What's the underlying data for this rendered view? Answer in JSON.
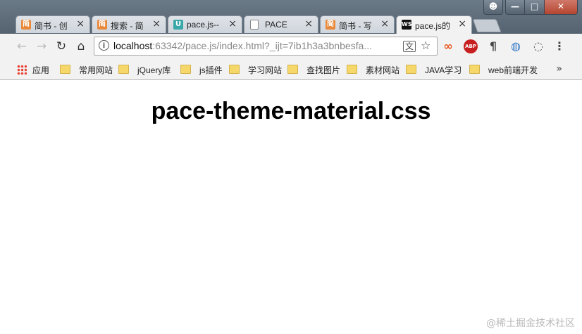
{
  "window": {
    "profile_icon": "person-icon",
    "minimize_icon": "minimize-icon",
    "maximize_icon": "maximize-icon",
    "close_icon": "close-icon"
  },
  "tabs": [
    {
      "title": "简书 - 创",
      "favicon": "简",
      "favicon_color": "#e8893c",
      "active": false
    },
    {
      "title": "搜索 - 简",
      "favicon": "简",
      "favicon_color": "#e8893c",
      "active": false
    },
    {
      "title": "pace.js--",
      "favicon": "U",
      "favicon_color": "#3aa8a8",
      "active": false
    },
    {
      "title": "PACE",
      "favicon": "doc",
      "favicon_color": "#ffffff",
      "active": false
    },
    {
      "title": "简书 - 写",
      "favicon": "简",
      "favicon_color": "#e8893c",
      "active": false
    },
    {
      "title": "pace.js的",
      "favicon": "WS",
      "favicon_color": "#111111",
      "active": true
    }
  ],
  "toolbar": {
    "back_icon": "back-arrow-icon",
    "forward_icon": "forward-arrow-icon",
    "reload_icon": "reload-icon",
    "home_icon": "home-icon",
    "url_host": "localhost",
    "url_rest": ":63342/pace.js/index.html?_ijt=7ib1h3a3bnbesfa...",
    "translate_icon": "translate-icon",
    "star_icon": "bookmark-star-icon",
    "menu_icon": "kebab-menu-icon"
  },
  "extensions": [
    {
      "name": "infinity-extension-icon",
      "glyph": "∞",
      "color": "#e8551c"
    },
    {
      "name": "adblock-plus-icon",
      "glyph": "ABP",
      "color": "#c71f1f"
    },
    {
      "name": "pilcrow-extension-icon",
      "glyph": "¶",
      "color": "#444"
    },
    {
      "name": "globe-extension-icon",
      "glyph": "◍",
      "color": "#3a7bc8"
    },
    {
      "name": "circle-extension-icon",
      "glyph": "◌",
      "color": "#555"
    }
  ],
  "bookmarks": {
    "apps_label": "应用",
    "items": [
      "常用网站",
      "jQuery库",
      "js插件",
      "学习网站",
      "查找图片",
      "素材网站",
      "JAVA学习",
      "web前端开发"
    ],
    "more": "»"
  },
  "page": {
    "heading": "pace-theme-material.css",
    "watermark": "@稀土掘金技术社区"
  }
}
